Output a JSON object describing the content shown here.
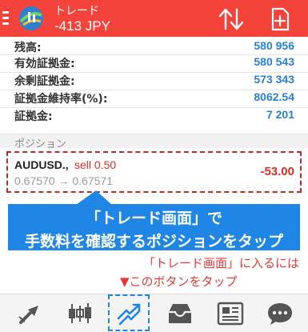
{
  "header": {
    "title": "トレード",
    "profit": "-413 JPY",
    "colors": {
      "bar": "#f4433a"
    },
    "icons": [
      "menu-icon",
      "app-logo",
      "sort-icon",
      "new-order-icon"
    ]
  },
  "account": [
    {
      "label": "残高:",
      "value": "580 956"
    },
    {
      "label": "有効証拠金:",
      "value": "580 543"
    },
    {
      "label": "余剰証拠金:",
      "value": "573 343"
    },
    {
      "label": "証拠金維持率(%):",
      "value": "8062.54"
    },
    {
      "label": "証拠金:",
      "value": "7 201"
    }
  ],
  "positions_section": {
    "title": "ポジション",
    "items": [
      {
        "symbol": "AUDUSD.,",
        "side": "sell 0.50",
        "prices": "0.67570 → 0.67571",
        "profit": "-53.00"
      }
    ]
  },
  "annotation": {
    "callout_line1": "「トレード画面」で",
    "callout_line2": "手数料を確認するポジションをタップ",
    "hint_line1": "「トレード画面」に入るには",
    "hint_line2": "▼このボタンをタップ",
    "colors": {
      "callout_bg": "#1f86e6",
      "hint": "#e53935",
      "box": "#c62828"
    }
  },
  "tabbar": {
    "items": [
      {
        "icon": "quotes-icon",
        "active": false
      },
      {
        "icon": "chart-icon",
        "active": false
      },
      {
        "icon": "trade-icon",
        "active": true
      },
      {
        "icon": "history-icon",
        "active": false
      },
      {
        "icon": "news-icon",
        "active": false
      },
      {
        "icon": "chat-icon",
        "active": false
      }
    ]
  }
}
